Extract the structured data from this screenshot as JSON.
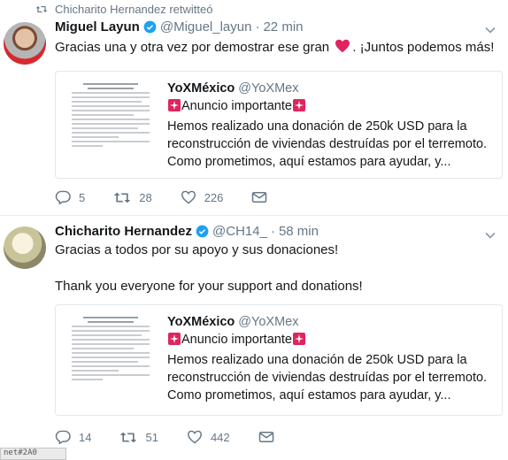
{
  "retweet_context": {
    "text": "Chicharito Hernandez retwitteó"
  },
  "tweets": [
    {
      "name": "Miguel Layun",
      "handle": "@Miguel_layun",
      "dot": "·",
      "time": "22 min",
      "text_before": "Gracias una y otra vez por demostrar ese gran",
      "text_after": ". ¡Juntos podemos más!",
      "card": {
        "name": "YoXMéxico",
        "handle": "@YoXMex",
        "line1": "Anuncio importante",
        "line2": "Hemos realizado una donación de 250k USD para la",
        "line3": "reconstrucción de viviendas destruídas por el terremoto.",
        "line4": "Como prometimos, aquí estamos para ayudar, y..."
      },
      "actions": {
        "replies": "5",
        "retweets": "28",
        "likes": "226"
      }
    },
    {
      "name": "Chicharito Hernandez",
      "handle": "@CH14_",
      "dot": "·",
      "time": "58 min",
      "text_line1": "Gracias a todos por su apoyo y sus donaciones!",
      "text_line2": "Thank you everyone for your support and donations!",
      "card": {
        "name": "YoXMéxico",
        "handle": "@YoXMex",
        "line1": "Anuncio importante",
        "line2": "Hemos realizado una donación de 250k USD para la",
        "line3": "reconstrucción de viviendas destruídas por el terremoto.",
        "line4": "Como prometimos, aquí estamos para ayudar, y..."
      },
      "actions": {
        "replies": "14",
        "retweets": "51",
        "likes": "442"
      }
    }
  ],
  "statusbar": {
    "text": "net#2A0"
  },
  "colors": {
    "verified": "#1da1f2",
    "heart": "#e0245e",
    "siren": "#e0245e",
    "secondary_text": "#657786"
  },
  "icons": [
    "retweet-icon",
    "verified-badge-icon",
    "caret-down-icon",
    "heart-emoji-icon",
    "siren-emoji-icon",
    "reply-icon",
    "like-icon",
    "direct-message-icon"
  ]
}
